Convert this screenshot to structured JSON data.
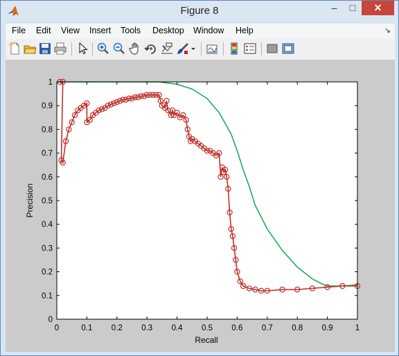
{
  "window": {
    "title": "Figure 8",
    "min_glyph": "–",
    "max_glyph": "□",
    "close_glyph": "✕"
  },
  "menu": [
    "File",
    "Edit",
    "View",
    "Insert",
    "Tools",
    "Desktop",
    "Window",
    "Help"
  ],
  "menu_arrow": "↘",
  "toolbar_icons": [
    "new-figure-icon",
    "open-file-icon",
    "save-icon",
    "print-icon",
    "pointer-icon",
    "zoom-in-icon",
    "zoom-out-icon",
    "pan-icon",
    "rotate-3d-icon",
    "data-cursor-icon",
    "brush-icon",
    "brush-dropdown-icon",
    "link-plot-icon",
    "insert-colorbar-icon",
    "insert-legend-icon",
    "hide-plot-tools-icon",
    "show-plot-tools-icon"
  ],
  "chart_data": {
    "type": "line",
    "title": "",
    "xlabel": "Recall",
    "ylabel": "Precision",
    "xlim": [
      0,
      1
    ],
    "ylim": [
      0,
      1
    ],
    "xticks": [
      "0",
      "0.1",
      "0.2",
      "0.3",
      "0.4",
      "0.5",
      "0.6",
      "0.7",
      "0.8",
      "0.9",
      "1"
    ],
    "yticks": [
      "0",
      "0.1",
      "0.2",
      "0.3",
      "0.4",
      "0.5",
      "0.6",
      "0.7",
      "0.8",
      "0.9",
      "1"
    ],
    "grid": false,
    "colors": {
      "red": "#c0302a",
      "green": "#10a850"
    },
    "series": [
      {
        "color": "#c0302a",
        "marker": "circle",
        "x": [
          0.01,
          0.02,
          0.015,
          0.02,
          0.03,
          0.04,
          0.05,
          0.06,
          0.07,
          0.08,
          0.09,
          0.1,
          0.1,
          0.11,
          0.12,
          0.13,
          0.14,
          0.15,
          0.16,
          0.17,
          0.18,
          0.19,
          0.2,
          0.21,
          0.22,
          0.23,
          0.24,
          0.25,
          0.26,
          0.27,
          0.28,
          0.29,
          0.3,
          0.31,
          0.32,
          0.33,
          0.34,
          0.345,
          0.35,
          0.36,
          0.365,
          0.37,
          0.38,
          0.385,
          0.39,
          0.4,
          0.41,
          0.42,
          0.43,
          0.435,
          0.44,
          0.445,
          0.45,
          0.46,
          0.47,
          0.48,
          0.49,
          0.5,
          0.51,
          0.52,
          0.53,
          0.54,
          0.545,
          0.55,
          0.555,
          0.56,
          0.565,
          0.57,
          0.575,
          0.58,
          0.585,
          0.59,
          0.595,
          0.6,
          0.61,
          0.62,
          0.64,
          0.66,
          0.68,
          0.7,
          0.75,
          0.8,
          0.85,
          0.9,
          0.95,
          1.0
        ],
        "y": [
          1.0,
          1.0,
          0.67,
          0.66,
          0.75,
          0.8,
          0.83,
          0.86,
          0.88,
          0.89,
          0.9,
          0.91,
          0.83,
          0.84,
          0.86,
          0.87,
          0.88,
          0.885,
          0.89,
          0.9,
          0.905,
          0.91,
          0.915,
          0.92,
          0.925,
          0.925,
          0.93,
          0.93,
          0.935,
          0.935,
          0.94,
          0.94,
          0.945,
          0.945,
          0.945,
          0.945,
          0.945,
          0.92,
          0.9,
          0.89,
          0.92,
          0.88,
          0.86,
          0.88,
          0.86,
          0.87,
          0.85,
          0.86,
          0.84,
          0.8,
          0.77,
          0.75,
          0.76,
          0.75,
          0.74,
          0.73,
          0.72,
          0.71,
          0.71,
          0.7,
          0.69,
          0.7,
          0.6,
          0.64,
          0.62,
          0.63,
          0.6,
          0.55,
          0.45,
          0.38,
          0.35,
          0.3,
          0.25,
          0.2,
          0.16,
          0.14,
          0.13,
          0.125,
          0.12,
          0.12,
          0.125,
          0.125,
          0.13,
          0.135,
          0.14,
          0.14
        ]
      },
      {
        "color": "#10a850",
        "marker": "none",
        "x": [
          0,
          0.34,
          0.4,
          0.45,
          0.5,
          0.54,
          0.58,
          0.6,
          0.62,
          0.64,
          0.66,
          0.7,
          0.75,
          0.8,
          0.85,
          0.88,
          0.9,
          0.95,
          1.0
        ],
        "y": [
          1.0,
          1.0,
          0.99,
          0.97,
          0.93,
          0.87,
          0.78,
          0.71,
          0.63,
          0.56,
          0.48,
          0.38,
          0.29,
          0.22,
          0.17,
          0.15,
          0.14,
          0.14,
          0.145
        ]
      }
    ]
  }
}
